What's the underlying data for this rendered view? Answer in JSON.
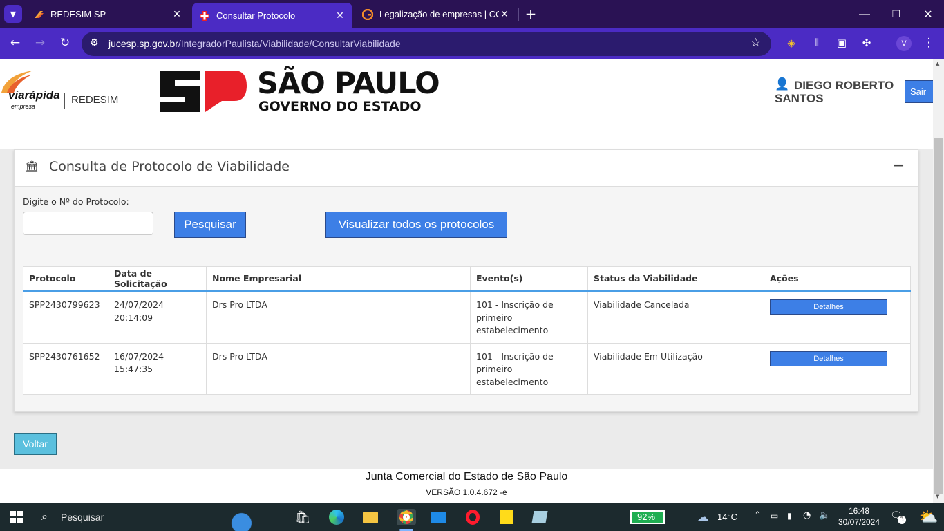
{
  "browser": {
    "tabs": [
      {
        "title": "REDESIM SP",
        "active": false
      },
      {
        "title": "Consultar Protocolo",
        "active": true
      },
      {
        "title": "Legalização de empresas | CON",
        "active": false
      }
    ],
    "new_tab_icon": "plus-icon",
    "url_host": "jucesp.sp.gov.br",
    "url_path": "/IntegradorPaulista/Viabilidade/ConsultarViabilidade",
    "profile_initial": "V"
  },
  "header": {
    "brand_logo_text": "viarápida",
    "brand_logo_sub": "empresa",
    "brand_separator_text": "REDESIM",
    "gov_title": "SÃO PAULO",
    "gov_subtitle": "GOVERNO DO ESTADO",
    "user_name_line1": "DIEGO ROBERTO",
    "user_name_line2": "SANTOS",
    "logout_label": "Sair"
  },
  "panel": {
    "title": "Consulta de Protocolo de Viabilidade",
    "collapse_label": "−",
    "protocol_label": "Digite o Nº do Protocolo:",
    "protocol_value": "",
    "search_button": "Pesquisar",
    "view_all_button": "Visualizar todos os protocolos"
  },
  "table": {
    "headers": [
      "Protocolo",
      "Data de Solicitação",
      "Nome Empresarial",
      "Evento(s)",
      "Status da Viabilidade",
      "Ações"
    ],
    "rows": [
      {
        "protocolo": "SPP2430799623",
        "data": "24/07/2024 20:14:09",
        "nome": "Drs Pro LTDA",
        "evento": "101 - Inscrição de primeiro estabelecimento",
        "status": "Viabilidade Cancelada",
        "acao": "Detalhes"
      },
      {
        "protocolo": "SPP2430761652",
        "data": "16/07/2024 15:47:35",
        "nome": "Drs Pro LTDA",
        "evento": "101 - Inscrição de primeiro estabelecimento",
        "status": "Viabilidade Em Utilização",
        "acao": "Detalhes"
      }
    ]
  },
  "back_button": "Voltar",
  "footer": {
    "org": "Junta Comercial do Estado de São Paulo",
    "version": "VERSÃO 1.0.4.672 -e"
  },
  "taskbar": {
    "search_placeholder": "Pesquisar",
    "battery": "92%",
    "temperature": "14°C",
    "time": "16:48",
    "date": "30/07/2024",
    "notifications": "3"
  },
  "colors": {
    "tabstrip": "#2a1254",
    "toolbar": "#4b2bc4",
    "primary_button": "#3d7fe6",
    "back_button": "#5bc0de",
    "table_header_rule": "#4a9ee6",
    "taskbar": "#1c2a2e",
    "sp_red": "#e8202a"
  }
}
